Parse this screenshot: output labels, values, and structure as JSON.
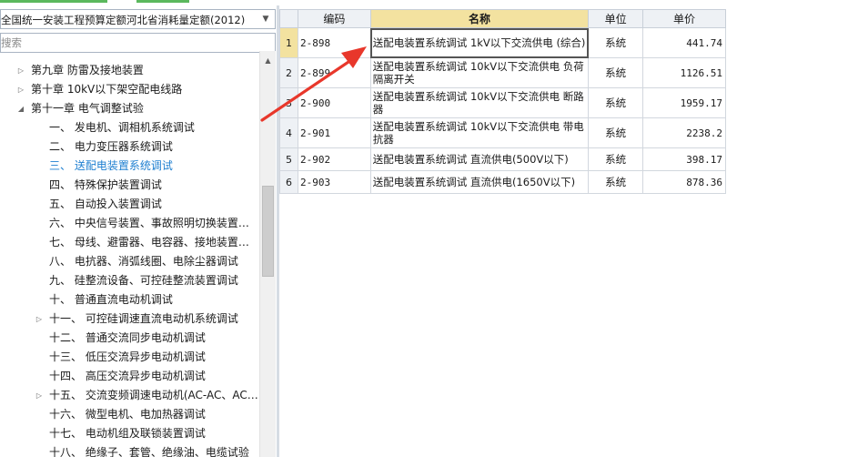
{
  "quota_select": {
    "value": "全国统一安装工程预算定额河北省消耗量定额(2012)"
  },
  "search": {
    "placeholder": "搜索"
  },
  "tree": [
    {
      "label": "第九章 防雷及接地装置",
      "level": 1,
      "expand": "collapsed"
    },
    {
      "label": "第十章 10kV以下架空配电线路",
      "level": 1,
      "expand": "collapsed"
    },
    {
      "label": "第十一章 电气调整试验",
      "level": 1,
      "expand": "expanded"
    },
    {
      "label": "一、 发电机、调相机系统调试",
      "level": 2,
      "expand": "none"
    },
    {
      "label": "二、 电力变压器系统调试",
      "level": 2,
      "expand": "none"
    },
    {
      "label": "三、 送配电装置系统调试",
      "level": 2,
      "expand": "none",
      "selected": true
    },
    {
      "label": "四、 特殊保护装置调试",
      "level": 2,
      "expand": "none"
    },
    {
      "label": "五、 自动投入装置调试",
      "level": 2,
      "expand": "none"
    },
    {
      "label": "六、 中央信号装置、事故照明切换装置…",
      "level": 2,
      "expand": "none"
    },
    {
      "label": "七、 母线、避雷器、电容器、接地装置…",
      "level": 2,
      "expand": "none"
    },
    {
      "label": "八、 电抗器、消弧线圈、电除尘器调试",
      "level": 2,
      "expand": "none"
    },
    {
      "label": "九、 硅整流设备、可控硅整流装置调试",
      "level": 2,
      "expand": "none"
    },
    {
      "label": "十、 普通直流电动机调试",
      "level": 2,
      "expand": "none"
    },
    {
      "label": "十一、 可控硅调速直流电动机系统调试",
      "level": 2,
      "expand": "collapsed"
    },
    {
      "label": "十二、 普通交流同步电动机调试",
      "level": 2,
      "expand": "none"
    },
    {
      "label": "十三、 低压交流异步电动机调试",
      "level": 2,
      "expand": "none"
    },
    {
      "label": "十四、 高压交流异步电动机调试",
      "level": 2,
      "expand": "none"
    },
    {
      "label": "十五、 交流变频调速电动机(AC-AC、AC…",
      "level": 2,
      "expand": "collapsed"
    },
    {
      "label": "十六、 微型电机、电加热器调试",
      "level": 2,
      "expand": "none"
    },
    {
      "label": "十七、 电动机组及联锁装置调试",
      "level": 2,
      "expand": "none"
    },
    {
      "label": "十八、 绝缘子、套管、绝缘油、电缆试验",
      "level": 2,
      "expand": "none"
    }
  ],
  "grid": {
    "headers": {
      "code": "编码",
      "name": "名称",
      "unit": "单位",
      "price": "单价"
    },
    "rows": [
      {
        "idx": "1",
        "code": "2-898",
        "name": "送配电装置系统调试 1kV以下交流供电 (综合)",
        "unit": "系统",
        "price": "441.74",
        "current": true
      },
      {
        "idx": "2",
        "code": "2-899",
        "name": "送配电装置系统调试 10kV以下交流供电 负荷隔离开关",
        "unit": "系统",
        "price": "1126.51"
      },
      {
        "idx": "3",
        "code": "2-900",
        "name": "送配电装置系统调试 10kV以下交流供电 断路器",
        "unit": "系统",
        "price": "1959.17"
      },
      {
        "idx": "4",
        "code": "2-901",
        "name": "送配电装置系统调试 10kV以下交流供电 带电抗器",
        "unit": "系统",
        "price": "2238.2"
      },
      {
        "idx": "5",
        "code": "2-902",
        "name": "送配电装置系统调试 直流供电(500V以下)",
        "unit": "系统",
        "price": "398.17"
      },
      {
        "idx": "6",
        "code": "2-903",
        "name": "送配电装置系统调试 直流供电(1650V以下)",
        "unit": "系统",
        "price": "878.36"
      }
    ]
  },
  "colors": {
    "accent": "#1e7fd0",
    "highlight": "#f3e2a0",
    "annotation_arrow": "#e8372b",
    "tab_green": "#5bb85d"
  }
}
